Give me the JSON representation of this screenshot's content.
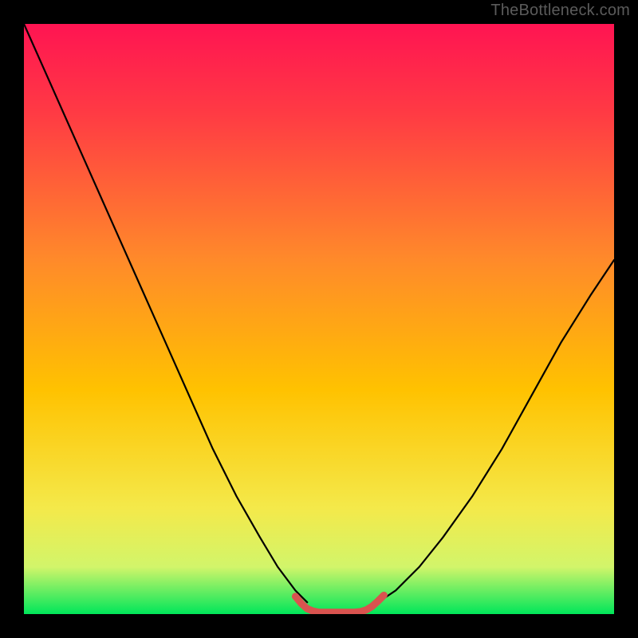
{
  "watermark": {
    "text": "TheBottleneck.com"
  },
  "chart_data": {
    "type": "line",
    "title": "",
    "xlabel": "",
    "ylabel": "",
    "xlim": [
      0,
      100
    ],
    "ylim": [
      0,
      100
    ],
    "grid": false,
    "legend": false,
    "background_gradient": {
      "top_color": "#ff1452",
      "mid_color": "#ffc200",
      "bottom_color": "#00e65a"
    },
    "series": [
      {
        "name": "left-curve",
        "stroke": "#000000",
        "x": [
          0,
          4,
          8,
          12,
          16,
          20,
          24,
          28,
          32,
          36,
          40,
          43,
          46,
          48
        ],
        "y": [
          100,
          91,
          82,
          73,
          64,
          55,
          46,
          37,
          28,
          20,
          13,
          8,
          4,
          2
        ]
      },
      {
        "name": "right-curve",
        "stroke": "#000000",
        "x": [
          60,
          63,
          67,
          71,
          76,
          81,
          86,
          91,
          96,
          100
        ],
        "y": [
          2,
          4,
          8,
          13,
          20,
          28,
          37,
          46,
          54,
          60
        ]
      },
      {
        "name": "bottom-marker",
        "stroke": "#d9534f",
        "x": [
          46,
          47,
          48,
          49,
          50,
          51,
          52,
          53,
          54,
          55,
          56,
          57,
          58,
          59,
          60,
          61
        ],
        "y": [
          3,
          1.8,
          0.9,
          0.5,
          0.3,
          0.3,
          0.3,
          0.3,
          0.3,
          0.3,
          0.3,
          0.4,
          0.7,
          1.3,
          2.2,
          3.2
        ]
      }
    ]
  }
}
